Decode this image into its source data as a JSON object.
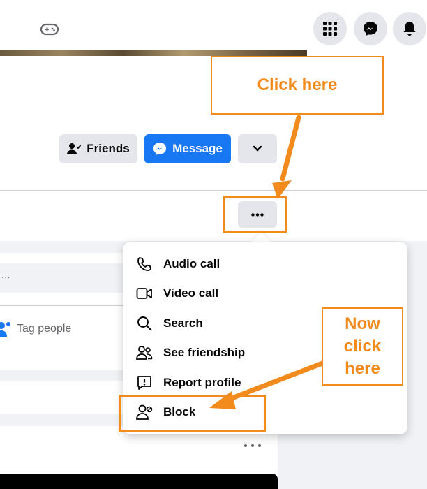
{
  "header": {
    "icons": [
      "gamepad-icon",
      "menu-grid-icon",
      "messenger-icon",
      "notifications-bell-icon"
    ]
  },
  "profile_actions": {
    "friends_label": "Friends",
    "message_label": "Message",
    "more_icon": "chevron-down-icon"
  },
  "tabs_row": {
    "more_icon": "ellipsis-icon"
  },
  "composer": {
    "placeholder": "...",
    "tag_people_label": "Tag people"
  },
  "menu": {
    "items": [
      {
        "label": "Audio call",
        "icon": "phone-icon"
      },
      {
        "label": "Video call",
        "icon": "video-camera-icon"
      },
      {
        "label": "Search",
        "icon": "search-icon"
      },
      {
        "label": "See friendship",
        "icon": "friends-icon"
      },
      {
        "label": "Report profile",
        "icon": "report-icon"
      },
      {
        "label": "Block",
        "icon": "block-user-icon"
      }
    ]
  },
  "annotations": {
    "callout_1": "Click here",
    "callout_2_lines": [
      "Now",
      "click",
      "here"
    ],
    "accent_color": "#f28a1c"
  },
  "colors": {
    "brand_blue": "#1877f2",
    "button_gray": "#e4e6eb",
    "feed_background": "#f0f2f5"
  }
}
